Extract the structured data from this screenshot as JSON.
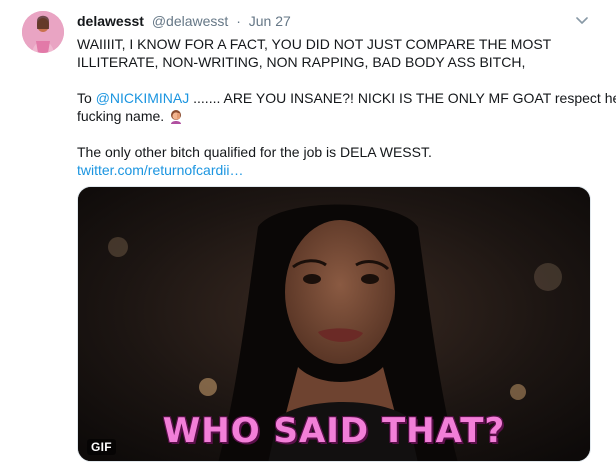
{
  "tweet": {
    "display_name": "delawesst",
    "handle": "@delawesst",
    "separator": "·",
    "date": "Jun 27",
    "text_line1": "WAIIIIT, I KNOW FOR A FACT, YOU DID NOT JUST COMPARE THE MOST",
    "text_line2": "ILLITERATE, NON-WRITING, NON RAPPING, BAD BODY ASS BITCH,",
    "text_line3_prefix": "To ",
    "mention": "@NICKIMINAJ",
    "text_line3_suffix": " ....... ARE YOU INSANE?! NICKI IS THE ONLY MF GOAT respect her",
    "text_line4": "fucking name. ",
    "text_line5": "The only other bitch qualified for the job is DELA WESST.",
    "link": "twitter.com/returnofcardii…",
    "emoji_icon": "woman-facepalming-icon"
  },
  "media": {
    "caption": "WHO SAID THAT?",
    "badge": "GIF",
    "type": "gif"
  },
  "icons": {
    "avatar": "profile-photo",
    "caret": "chevron-down-icon"
  },
  "colors": {
    "link": "#1b95e0",
    "muted": "#657786",
    "caption": "#f27fd8"
  }
}
